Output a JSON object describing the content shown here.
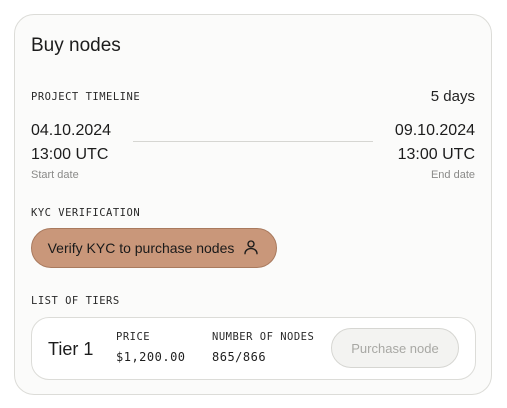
{
  "card": {
    "title": "Buy nodes"
  },
  "timeline": {
    "label": "PROJECT TIMELINE",
    "duration": "5 days",
    "start": {
      "date": "04.10.2024",
      "time": "13:00 UTC",
      "caption": "Start date"
    },
    "end": {
      "date": "09.10.2024",
      "time": "13:00 UTC",
      "caption": "End date"
    }
  },
  "kyc": {
    "label": "KYC VERIFICATION",
    "button_label": "Verify KYC to purchase nodes",
    "button_icon": "user-icon",
    "button_color": "#c9977a"
  },
  "tiers": {
    "label": "LIST OF TIERS",
    "items": [
      {
        "name": "Tier 1",
        "price_label": "PRICE",
        "price": "$1,200.00",
        "nodes_label": "NUMBER OF NODES",
        "nodes": "865/866",
        "action_label": "Purchase node"
      }
    ]
  }
}
